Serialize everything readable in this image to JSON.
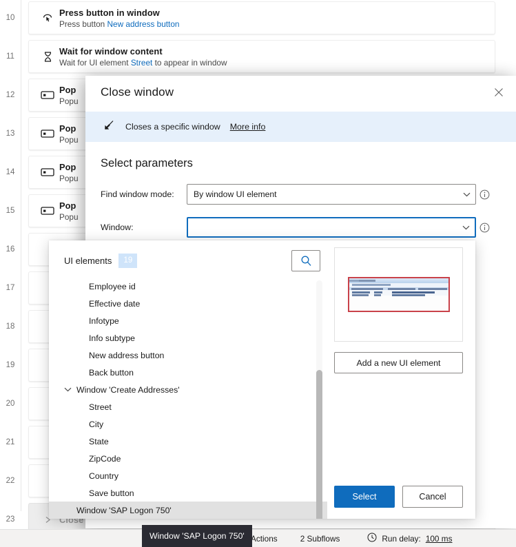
{
  "flow": {
    "rows": [
      {
        "num": "10",
        "title": "Press button in window",
        "sub_prefix": "Press button ",
        "sub_link": "New address button",
        "icon": "press-button-icon"
      },
      {
        "num": "11",
        "title": "Wait for window content",
        "sub_prefix": "Wait for UI element ",
        "sub_link": "Street",
        "sub_suffix": " to appear in window",
        "icon": "hourglass-icon"
      },
      {
        "num": "12",
        "title": "Pop",
        "sub_prefix": "Popu",
        "icon": "populate-text-field-icon"
      },
      {
        "num": "13",
        "title": "Pop",
        "sub_prefix": "Popu",
        "icon": "populate-text-field-icon"
      },
      {
        "num": "14",
        "title": "Pop",
        "sub_prefix": "Popu",
        "icon": "populate-text-field-icon"
      },
      {
        "num": "15",
        "title": "Pop",
        "sub_prefix": "Popu",
        "icon": "populate-text-field-icon"
      },
      {
        "num": "16",
        "title": "",
        "sub_prefix": "",
        "icon": ""
      },
      {
        "num": "17",
        "title": "",
        "sub_prefix": "",
        "icon": ""
      },
      {
        "num": "18",
        "title": "",
        "sub_prefix": "",
        "icon": ""
      },
      {
        "num": "19",
        "title": "",
        "sub_prefix": "",
        "icon": ""
      },
      {
        "num": "20",
        "title": "",
        "sub_prefix": "",
        "icon": ""
      },
      {
        "num": "21",
        "title": "",
        "sub_prefix": "",
        "icon": ""
      },
      {
        "num": "22",
        "title": "",
        "sub_prefix": "",
        "icon": ""
      },
      {
        "num": "23",
        "title": "Close window",
        "sub_prefix": "",
        "icon": "chevron-right-icon"
      }
    ]
  },
  "dialog": {
    "title": "Close window",
    "close_label": "✕",
    "banner": {
      "description": "Closes a specific window",
      "more_info": "More info"
    },
    "params_title": "Select parameters",
    "find_window_mode": {
      "label": "Find window mode:",
      "value": "By window UI element"
    },
    "window": {
      "label": "Window:",
      "value": ""
    }
  },
  "picker": {
    "title": "UI elements",
    "count": "19",
    "search_icon": "search-icon",
    "add_button": "Add a new UI element",
    "select_button": "Select",
    "cancel_button": "Cancel",
    "tree": [
      {
        "label": "Employee id",
        "type": "leaf",
        "selected": false
      },
      {
        "label": "Effective date",
        "type": "leaf",
        "selected": false
      },
      {
        "label": "Infotype",
        "type": "leaf",
        "selected": false
      },
      {
        "label": "Info subtype",
        "type": "leaf",
        "selected": false
      },
      {
        "label": "New address button",
        "type": "leaf",
        "selected": false
      },
      {
        "label": "Back button",
        "type": "leaf",
        "selected": false
      },
      {
        "label": "Window 'Create Addresses'",
        "type": "group",
        "selected": false
      },
      {
        "label": "Street",
        "type": "leaf",
        "selected": false
      },
      {
        "label": "City",
        "type": "leaf",
        "selected": false
      },
      {
        "label": "State",
        "type": "leaf",
        "selected": false
      },
      {
        "label": "ZipCode",
        "type": "leaf",
        "selected": false
      },
      {
        "label": "Country",
        "type": "leaf",
        "selected": false
      },
      {
        "label": "Save button",
        "type": "leaf",
        "selected": false
      },
      {
        "label": "Window 'SAP Logon 750'",
        "type": "group-selected",
        "selected": true
      }
    ]
  },
  "tooltip": {
    "text": "Window 'SAP Logon 750'"
  },
  "statusbar": {
    "actions": "Actions",
    "subflows": "2 Subflows",
    "run_delay_label": "Run delay:",
    "run_delay_value": "100 ms",
    "clock_icon": "clock-icon"
  },
  "colors": {
    "accent": "#0f6cbd",
    "banner_bg": "#e6f0fb",
    "selection": "#e1e1e1",
    "thumb_border": "#c9424a",
    "tooltip_bg": "#2b2b33"
  }
}
